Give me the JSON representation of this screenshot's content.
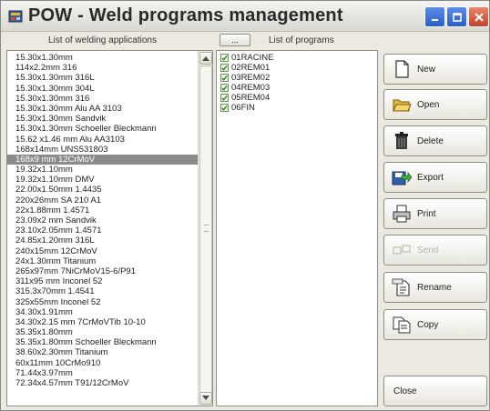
{
  "window": {
    "title": "POW - Weld programs management"
  },
  "headers": {
    "applications": "List of welding applications",
    "programs": "List of programs",
    "nav_button": "..."
  },
  "applications": [
    "15.30x1.30mm",
    "114x2.2mm 316",
    "15.30x1.30mm 316L",
    "15.30x1.30mm 304L",
    "15.30x1.30mm 316",
    "15.30x1.30mm Alu AA 3103",
    "15.30x1.30mm Sandvik",
    "15.30x1.30mm Schoeller Bleckmann",
    "15.62 x1.46 mm Alu AA3103",
    "168x14mm UNS531803",
    "168x9 mm 12CrMoV",
    "19.32x1.10mm",
    "19.32x1.10mm DMV",
    "22.00x1.50mm 1.4435",
    "220x26mm SA 210 A1",
    "22x1.88mm 1.4571",
    "23.09x2 mm Sandvik",
    "23.10x2.05mm 1.4571",
    "24.85x1.20mm 316L",
    "240x15mm 12CrMoV",
    "24x1.30mm Titanium",
    "265x97mm 7NiCrMoV15-6/P91",
    "311x95 mm Inconel 52",
    "315.3x70mm 1.4541",
    "325x55mm Inconel 52",
    "34.30x1.91mm",
    "34.30x2.15 mm 7CrMoVTib 10-10",
    "35.35x1.80mm",
    "35.35x1.80mm Schoeller Bleckmann",
    "38.60x2.30mm Titanium",
    "60x11mm 10CrMo910",
    "71.44x3.97mm",
    "72.34x4.57mm T91/12CrMoV"
  ],
  "selected_application_index": 10,
  "programs": [
    "01RACINE",
    "02REM01",
    "03REM02",
    "04REM03",
    "05REM04",
    "06FIN"
  ],
  "buttons": {
    "new": "New",
    "open": "Open",
    "delete": "Delete",
    "export": "Export",
    "print": "Print",
    "send": "Send",
    "rename": "Rename",
    "copy": "Copy",
    "close": "Close"
  },
  "icons": {
    "app": "weld-app-icon",
    "new": "blank-document-icon",
    "open": "open-folder-icon",
    "delete": "trash-can-icon",
    "export": "export-disk-icon",
    "print": "printer-icon",
    "send": "send-network-icon",
    "rename": "rename-document-icon",
    "copy": "copy-documents-icon"
  }
}
